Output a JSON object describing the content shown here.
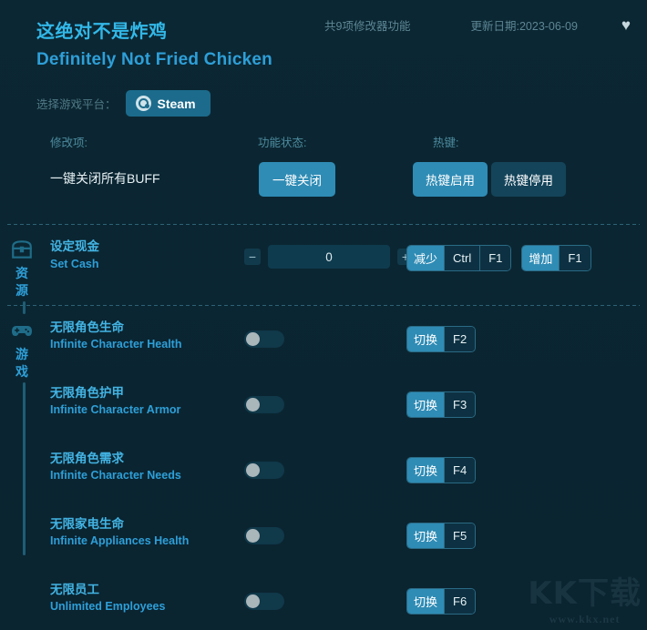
{
  "header": {
    "title_cn": "这绝对不是炸鸡",
    "title_en": "Definitely Not Fried Chicken",
    "feature_count": "共9项修改器功能",
    "update_date": "更新日期:2023-06-09",
    "favorite_icon": "♥",
    "platform_label": "选择游戏平台：",
    "platform_button": "Steam"
  },
  "columns": {
    "modifier": "修改项:",
    "status": "功能状态:",
    "hotkey": "热键:"
  },
  "global": {
    "label": "一键关闭所有BUFF",
    "close_button": "一键关闭",
    "hotkey_enable": "热键启用",
    "hotkey_disable": "热键停用"
  },
  "sections": [
    {
      "id": "resources",
      "name": "资源",
      "icon": "treasure-chest-icon",
      "options": [
        {
          "name_cn": "设定现金",
          "name_en": "Set Cash",
          "control": "stepper",
          "value": "0",
          "minus": "−",
          "plus": "+",
          "hotkeys": [
            {
              "action": "减少",
              "keys": [
                "Ctrl",
                "F1"
              ]
            },
            {
              "action": "增加",
              "keys": [
                "F1"
              ]
            }
          ]
        }
      ]
    },
    {
      "id": "game",
      "name": "游戏",
      "icon": "gamepad-icon",
      "options": [
        {
          "name_cn": "无限角色生命",
          "name_en": "Infinite Character Health",
          "control": "toggle",
          "value": "off",
          "hotkeys": [
            {
              "action": "切换",
              "keys": [
                "F2"
              ]
            }
          ]
        },
        {
          "name_cn": "无限角色护甲",
          "name_en": "Infinite Character Armor",
          "control": "toggle",
          "value": "off",
          "hotkeys": [
            {
              "action": "切换",
              "keys": [
                "F3"
              ]
            }
          ]
        },
        {
          "name_cn": "无限角色需求",
          "name_en": "Infinite Character Needs",
          "control": "toggle",
          "value": "off",
          "hotkeys": [
            {
              "action": "切换",
              "keys": [
                "F4"
              ]
            }
          ]
        },
        {
          "name_cn": "无限家电生命",
          "name_en": "Infinite Appliances Health",
          "control": "toggle",
          "value": "off",
          "hotkeys": [
            {
              "action": "切换",
              "keys": [
                "F5"
              ]
            }
          ]
        },
        {
          "name_cn": "无限员工",
          "name_en": "Unlimited Employees",
          "control": "toggle",
          "value": "off",
          "hotkeys": [
            {
              "action": "切换",
              "keys": [
                "F6"
              ]
            }
          ]
        }
      ]
    }
  ],
  "watermark": {
    "logo": "KK下载",
    "url": "www.kkx.net"
  },
  "colors": {
    "background": "#0a2530",
    "accent": "#2f8cb5",
    "title": "#32b8e8",
    "label_muted": "#4d8b9e",
    "option_name": "#43b4e4"
  }
}
